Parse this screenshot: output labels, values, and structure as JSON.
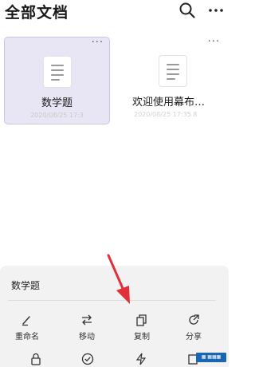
{
  "header": {
    "title": "全部文档",
    "search_icon": "search-icon",
    "more_icon": "more-horizontal-icon"
  },
  "documents": [
    {
      "name": "数学题",
      "meta": "2020/08/25 17:3",
      "selected": true
    },
    {
      "name": "欢迎使用幕布…",
      "meta": "2020/08/25 17:35  8",
      "selected": false
    }
  ],
  "sheet": {
    "title": "数学题",
    "actions": [
      {
        "label": "重命名",
        "icon": "rename-pen-icon"
      },
      {
        "label": "移动",
        "icon": "move-arrows-icon"
      },
      {
        "label": "复制",
        "icon": "copy-icon"
      },
      {
        "label": "分享",
        "icon": "share-icon"
      }
    ],
    "row2_icons": [
      "lock-icon",
      "check-circle-icon",
      "lightning-icon",
      "export-icon"
    ]
  },
  "colors": {
    "selected_card_bg": "#e8e6f4",
    "annotation_arrow": "#e0303a",
    "sheet_bg": "#f2f2f2"
  }
}
